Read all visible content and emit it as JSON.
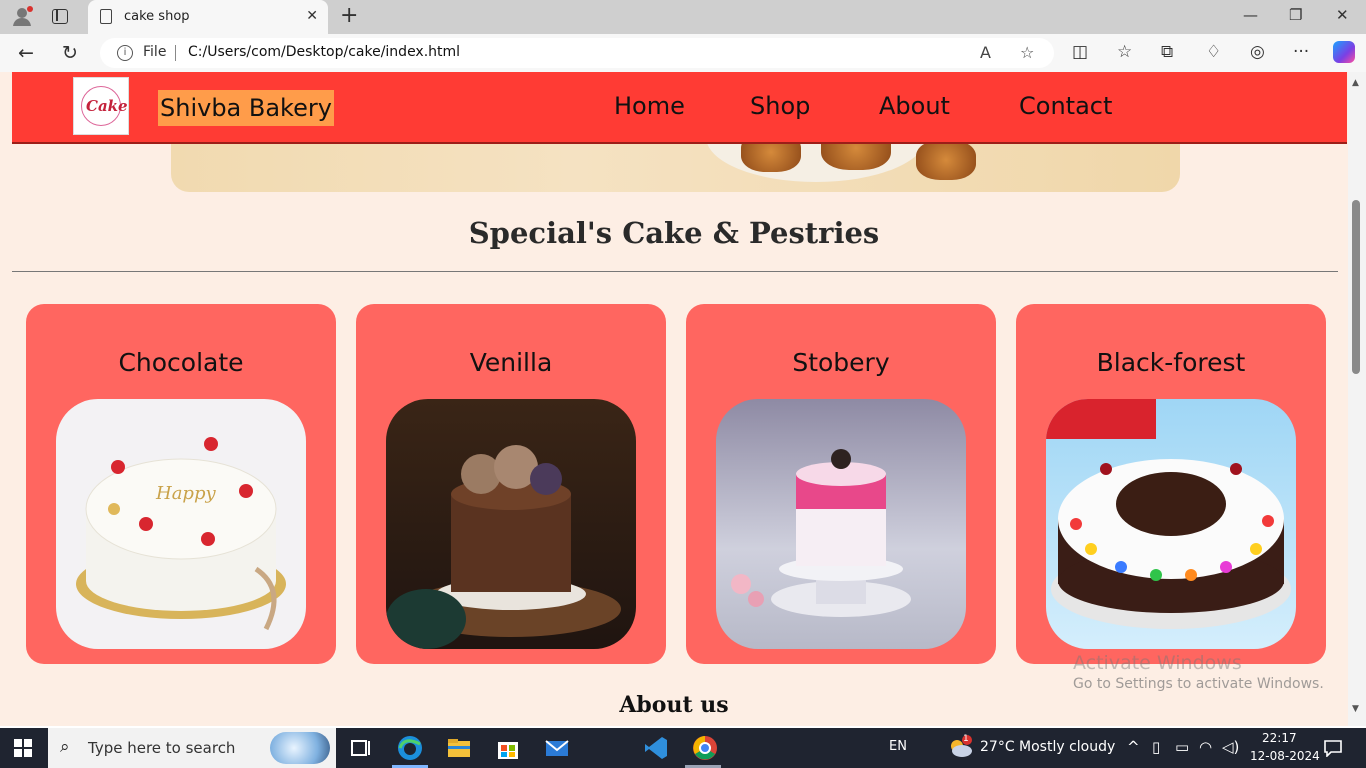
{
  "browser": {
    "tab_title": "cake shop",
    "tab_close": "✕",
    "new_tab": "+",
    "url_scheme_label": "File",
    "url": "C:/Users/com/Desktop/cake/index.html",
    "window_controls": {
      "minimize": "—",
      "maximize": "❐",
      "close": "✕"
    },
    "icons": {
      "back": "←",
      "refresh": "↻",
      "read_aloud": "A",
      "favorite": "☆",
      "split": "◫",
      "favorites": "☆",
      "collections": "⧉",
      "extensions": "♢",
      "sync": "◎",
      "more": "···"
    }
  },
  "site": {
    "logo_text": "Cake",
    "brand": "Shivba Bakery",
    "nav": [
      "Home",
      "Shop",
      "About",
      "Contact"
    ],
    "section_title": "Special's Cake & Pestries",
    "cards": [
      {
        "title": "Chocolate"
      },
      {
        "title": "Venilla"
      },
      {
        "title": "Stobery"
      },
      {
        "title": "Black-forest"
      }
    ],
    "about_title": "About us",
    "watermark_title": "Activate Windows",
    "watermark_sub": "Go to Settings to activate Windows."
  },
  "taskbar": {
    "search_placeholder": "Type here to search",
    "language": "EN",
    "weather": "27°C  Mostly cloudy",
    "time": "22:17",
    "date": "12-08-2024",
    "weather_badge": "1"
  },
  "colors": {
    "header": "#ff3b34",
    "brand_highlight": "#ff9c4a",
    "card": "#ff6660",
    "page_bg": "#fdeee4",
    "taskbar": "#1f2430"
  }
}
